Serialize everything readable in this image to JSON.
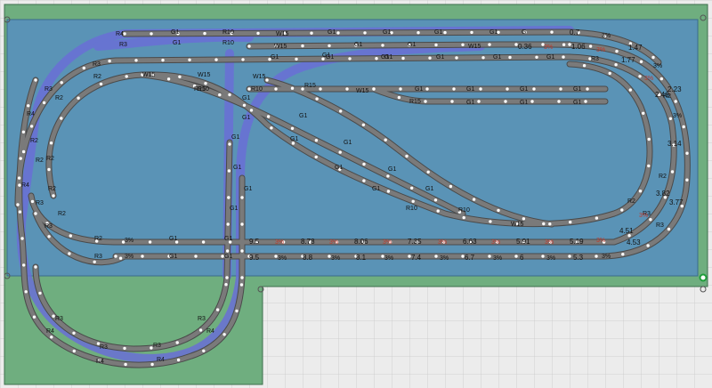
{
  "colors": {
    "canvas": "#ececec",
    "grid_line": "#cfcfcf",
    "baseboard": "#5a93b6",
    "baseboard_edge": "#3a6b8c",
    "margin_green": "#6fae7f",
    "track": "#7a7a7a",
    "track_edge": "#4a4a4a",
    "upper_track_glow": "#6a6fd6",
    "joint_dot": "#ffffff",
    "grade_text_red": "#c0392b",
    "anchor_green": "#1f9d3a"
  },
  "track_labels": {
    "inner_loop": [
      "R2",
      "R3",
      "R2",
      "R3",
      "R2",
      "R3",
      "R2",
      "R2",
      "R2",
      "R3",
      "R2",
      "R2",
      "R3",
      "R3",
      "R3",
      "R3"
    ],
    "outer_loop": [
      "R3",
      "R4",
      "R3",
      "R4",
      "R3",
      "R4",
      "R4",
      "R3",
      "R4",
      "R4"
    ],
    "crossover": [
      "R10",
      "R10",
      "R10",
      "R10",
      "R15",
      "R15",
      "W15",
      "W15",
      "W15",
      "W15",
      "W15",
      "G1",
      "G1",
      "G1",
      "G1",
      "G1",
      "G1",
      "G1",
      "G1",
      "G1",
      "G1"
    ],
    "upper_level": [
      "R4",
      "R3",
      "G1",
      "G1",
      "R10",
      "R10",
      "W15",
      "G1",
      "G1",
      "G1",
      "G1",
      "G1",
      "G",
      "W15",
      "G1",
      "G1",
      "G1",
      "G1",
      "G1",
      "R2",
      "R2",
      "R2",
      "G1",
      "G1",
      "G1",
      "G1"
    ],
    "siding": [
      "W15",
      "G1",
      "G1",
      "G1",
      "G1",
      "G1",
      "R15",
      "G1",
      "G1",
      "G1",
      "G1",
      "G1"
    ],
    "bottom_straight": [
      "G1",
      "G1",
      "G1",
      "G1",
      "G1",
      "G1",
      "G1",
      "G1",
      "G1",
      "G1",
      "G1",
      "G1"
    ]
  },
  "heights_right": [
    "0.7",
    "1.47",
    "1.77",
    "2.23",
    "2.46",
    "3.14",
    "3.82",
    "3.77",
    "4.51",
    "4.53"
  ],
  "heights_top": [
    "0.36",
    "1.06"
  ],
  "heights_bottom_inner": [
    "9.5",
    "8.78",
    "8.06",
    "7.35",
    "6.63",
    "5.91",
    "5.19"
  ],
  "heights_bottom_outer": [
    "9.5",
    "8.8",
    "8.1",
    "7.4",
    "6.7",
    "6",
    "5.3"
  ],
  "grades": [
    "3%",
    "3%",
    "3%",
    "3%",
    "3%",
    "3%",
    "3%",
    "3%",
    "3%",
    "3%",
    "3%",
    "3%",
    "3%",
    "3%",
    "3%",
    "3%",
    "3%",
    "3%",
    "3%",
    "3%",
    "3%",
    "3%",
    "3%"
  ]
}
